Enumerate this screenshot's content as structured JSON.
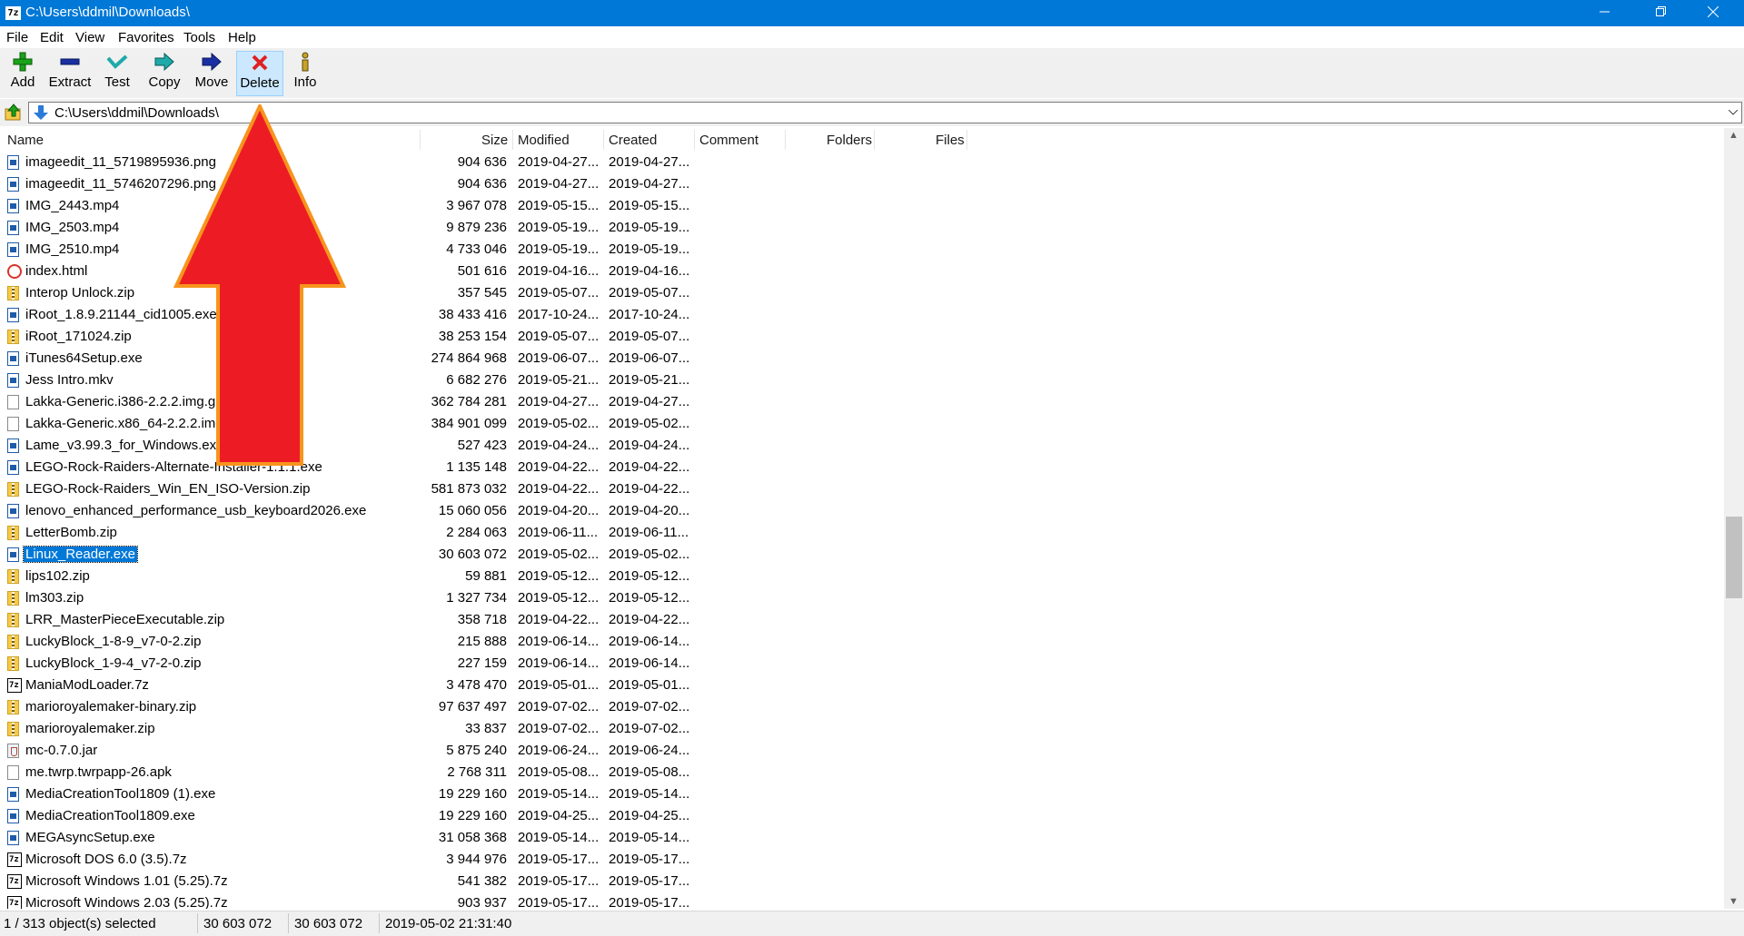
{
  "window": {
    "app_icon": "7z",
    "title": "C:\\Users\\ddmil\\Downloads\\",
    "minimize_icon": "minimize-icon",
    "maximize_icon": "restore-icon",
    "close_icon": "close-icon"
  },
  "menu": [
    "File",
    "Edit",
    "View",
    "Favorites",
    "Tools",
    "Help"
  ],
  "toolbar": [
    {
      "label": "Add",
      "icon": "plus-icon",
      "color": "#1aa31a"
    },
    {
      "label": "Extract",
      "icon": "minus-icon",
      "color": "#1a2fa3"
    },
    {
      "label": "Test",
      "icon": "check-icon",
      "color": "#1fa9a9"
    },
    {
      "label": "Copy",
      "icon": "copy-arrow-icon",
      "color": "#1fa9a9"
    },
    {
      "label": "Move",
      "icon": "move-arrow-icon",
      "color": "#1a2fa3"
    },
    {
      "label": "Delete",
      "icon": "delete-x-icon",
      "color": "#e02020"
    },
    {
      "label": "Info",
      "icon": "info-icon",
      "color": "#c9a227"
    }
  ],
  "address": {
    "path": "C:\\Users\\ddmil\\Downloads\\"
  },
  "columns": {
    "name": "Name",
    "size": "Size",
    "modified": "Modified",
    "created": "Created",
    "comment": "Comment",
    "folders": "Folders",
    "files": "Files"
  },
  "files": [
    {
      "name": "imageedit_11_5719895936.png",
      "size": "904 636",
      "modified": "2019-04-27...",
      "created": "2019-04-27...",
      "type": "exe"
    },
    {
      "name": "imageedit_11_5746207296.png",
      "size": "904 636",
      "modified": "2019-04-27...",
      "created": "2019-04-27...",
      "type": "exe"
    },
    {
      "name": "IMG_2443.mp4",
      "size": "3 967 078",
      "modified": "2019-05-15...",
      "created": "2019-05-15...",
      "type": "exe"
    },
    {
      "name": "IMG_2503.mp4",
      "size": "9 879 236",
      "modified": "2019-05-19...",
      "created": "2019-05-19...",
      "type": "exe"
    },
    {
      "name": "IMG_2510.mp4",
      "size": "4 733 046",
      "modified": "2019-05-19...",
      "created": "2019-05-19...",
      "type": "exe"
    },
    {
      "name": "index.html",
      "size": "501 616",
      "modified": "2019-04-16...",
      "created": "2019-04-16...",
      "type": "html"
    },
    {
      "name": "Interop Unlock.zip",
      "size": "357 545",
      "modified": "2019-05-07...",
      "created": "2019-05-07...",
      "type": "zip"
    },
    {
      "name": "iRoot_1.8.9.21144_cid1005.exe",
      "size": "38 433 416",
      "modified": "2017-10-24...",
      "created": "2017-10-24...",
      "type": "exe"
    },
    {
      "name": "iRoot_171024.zip",
      "size": "38 253 154",
      "modified": "2019-05-07...",
      "created": "2019-05-07...",
      "type": "zip"
    },
    {
      "name": "iTunes64Setup.exe",
      "size": "274 864 968",
      "modified": "2019-06-07...",
      "created": "2019-06-07...",
      "type": "exe"
    },
    {
      "name": "Jess Intro.mkv",
      "size": "6 682 276",
      "modified": "2019-05-21...",
      "created": "2019-05-21...",
      "type": "exe"
    },
    {
      "name": "Lakka-Generic.i386-2.2.2.img.gz",
      "size": "362 784 281",
      "modified": "2019-04-27...",
      "created": "2019-04-27...",
      "type": "file"
    },
    {
      "name": "Lakka-Generic.x86_64-2.2.2.img",
      "size": "384 901 099",
      "modified": "2019-05-02...",
      "created": "2019-05-02...",
      "type": "file"
    },
    {
      "name": "Lame_v3.99.3_for_Windows.exe",
      "size": "527 423",
      "modified": "2019-04-24...",
      "created": "2019-04-24...",
      "type": "exe"
    },
    {
      "name": "LEGO-Rock-Raiders-Alternate-Installer-1.1.1.exe",
      "size": "1 135 148",
      "modified": "2019-04-22...",
      "created": "2019-04-22...",
      "type": "exe"
    },
    {
      "name": "LEGO-Rock-Raiders_Win_EN_ISO-Version.zip",
      "size": "581 873 032",
      "modified": "2019-04-22...",
      "created": "2019-04-22...",
      "type": "zip"
    },
    {
      "name": "lenovo_enhanced_performance_usb_keyboard2026.exe",
      "size": "15 060 056",
      "modified": "2019-04-20...",
      "created": "2019-04-20...",
      "type": "exe"
    },
    {
      "name": "LetterBomb.zip",
      "size": "2 284 063",
      "modified": "2019-06-11...",
      "created": "2019-06-11...",
      "type": "zip"
    },
    {
      "name": "Linux_Reader.exe",
      "size": "30 603 072",
      "modified": "2019-05-02...",
      "created": "2019-05-02...",
      "type": "exe",
      "selected": true
    },
    {
      "name": "lips102.zip",
      "size": "59 881",
      "modified": "2019-05-12...",
      "created": "2019-05-12...",
      "type": "zip"
    },
    {
      "name": "lm303.zip",
      "size": "1 327 734",
      "modified": "2019-05-12...",
      "created": "2019-05-12...",
      "type": "zip"
    },
    {
      "name": "LRR_MasterPieceExecutable.zip",
      "size": "358 718",
      "modified": "2019-04-22...",
      "created": "2019-04-22...",
      "type": "zip"
    },
    {
      "name": "LuckyBlock_1-8-9_v7-0-2.zip",
      "size": "215 888",
      "modified": "2019-06-14...",
      "created": "2019-06-14...",
      "type": "zip"
    },
    {
      "name": "LuckyBlock_1-9-4_v7-2-0.zip",
      "size": "227 159",
      "modified": "2019-06-14...",
      "created": "2019-06-14...",
      "type": "zip"
    },
    {
      "name": "ManiaModLoader.7z",
      "size": "3 478 470",
      "modified": "2019-05-01...",
      "created": "2019-05-01...",
      "type": "7z"
    },
    {
      "name": "marioroyalemaker-binary.zip",
      "size": "97 637 497",
      "modified": "2019-07-02...",
      "created": "2019-07-02...",
      "type": "zip"
    },
    {
      "name": "marioroyalemaker.zip",
      "size": "33 837",
      "modified": "2019-07-02...",
      "created": "2019-07-02...",
      "type": "zip"
    },
    {
      "name": "mc-0.7.0.jar",
      "size": "5 875 240",
      "modified": "2019-06-24...",
      "created": "2019-06-24...",
      "type": "jar"
    },
    {
      "name": "me.twrp.twrpapp-26.apk",
      "size": "2 768 311",
      "modified": "2019-05-08...",
      "created": "2019-05-08...",
      "type": "file"
    },
    {
      "name": "MediaCreationTool1809 (1).exe",
      "size": "19 229 160",
      "modified": "2019-05-14...",
      "created": "2019-05-14...",
      "type": "exe"
    },
    {
      "name": "MediaCreationTool1809.exe",
      "size": "19 229 160",
      "modified": "2019-04-25...",
      "created": "2019-04-25...",
      "type": "exe"
    },
    {
      "name": "MEGAsyncSetup.exe",
      "size": "31 058 368",
      "modified": "2019-05-14...",
      "created": "2019-05-14...",
      "type": "exe"
    },
    {
      "name": "Microsoft DOS 6.0 (3.5).7z",
      "size": "3 944 976",
      "modified": "2019-05-17...",
      "created": "2019-05-17...",
      "type": "7z"
    },
    {
      "name": "Microsoft Windows 1.01 (5.25).7z",
      "size": "541 382",
      "modified": "2019-05-17...",
      "created": "2019-05-17...",
      "type": "7z"
    },
    {
      "name": "Microsoft Windows 2.03 (5.25).7z",
      "size": "903 937",
      "modified": "2019-05-17...",
      "created": "2019-05-17...",
      "type": "7z"
    }
  ],
  "status": {
    "selection": "1 / 313 object(s) selected",
    "size1": "30 603 072",
    "size2": "30 603 072",
    "datetime": "2019-05-02 21:31:40"
  },
  "annotation": {
    "color": "#ed1c24",
    "outline": "#f7941d",
    "points_to": "Delete"
  }
}
